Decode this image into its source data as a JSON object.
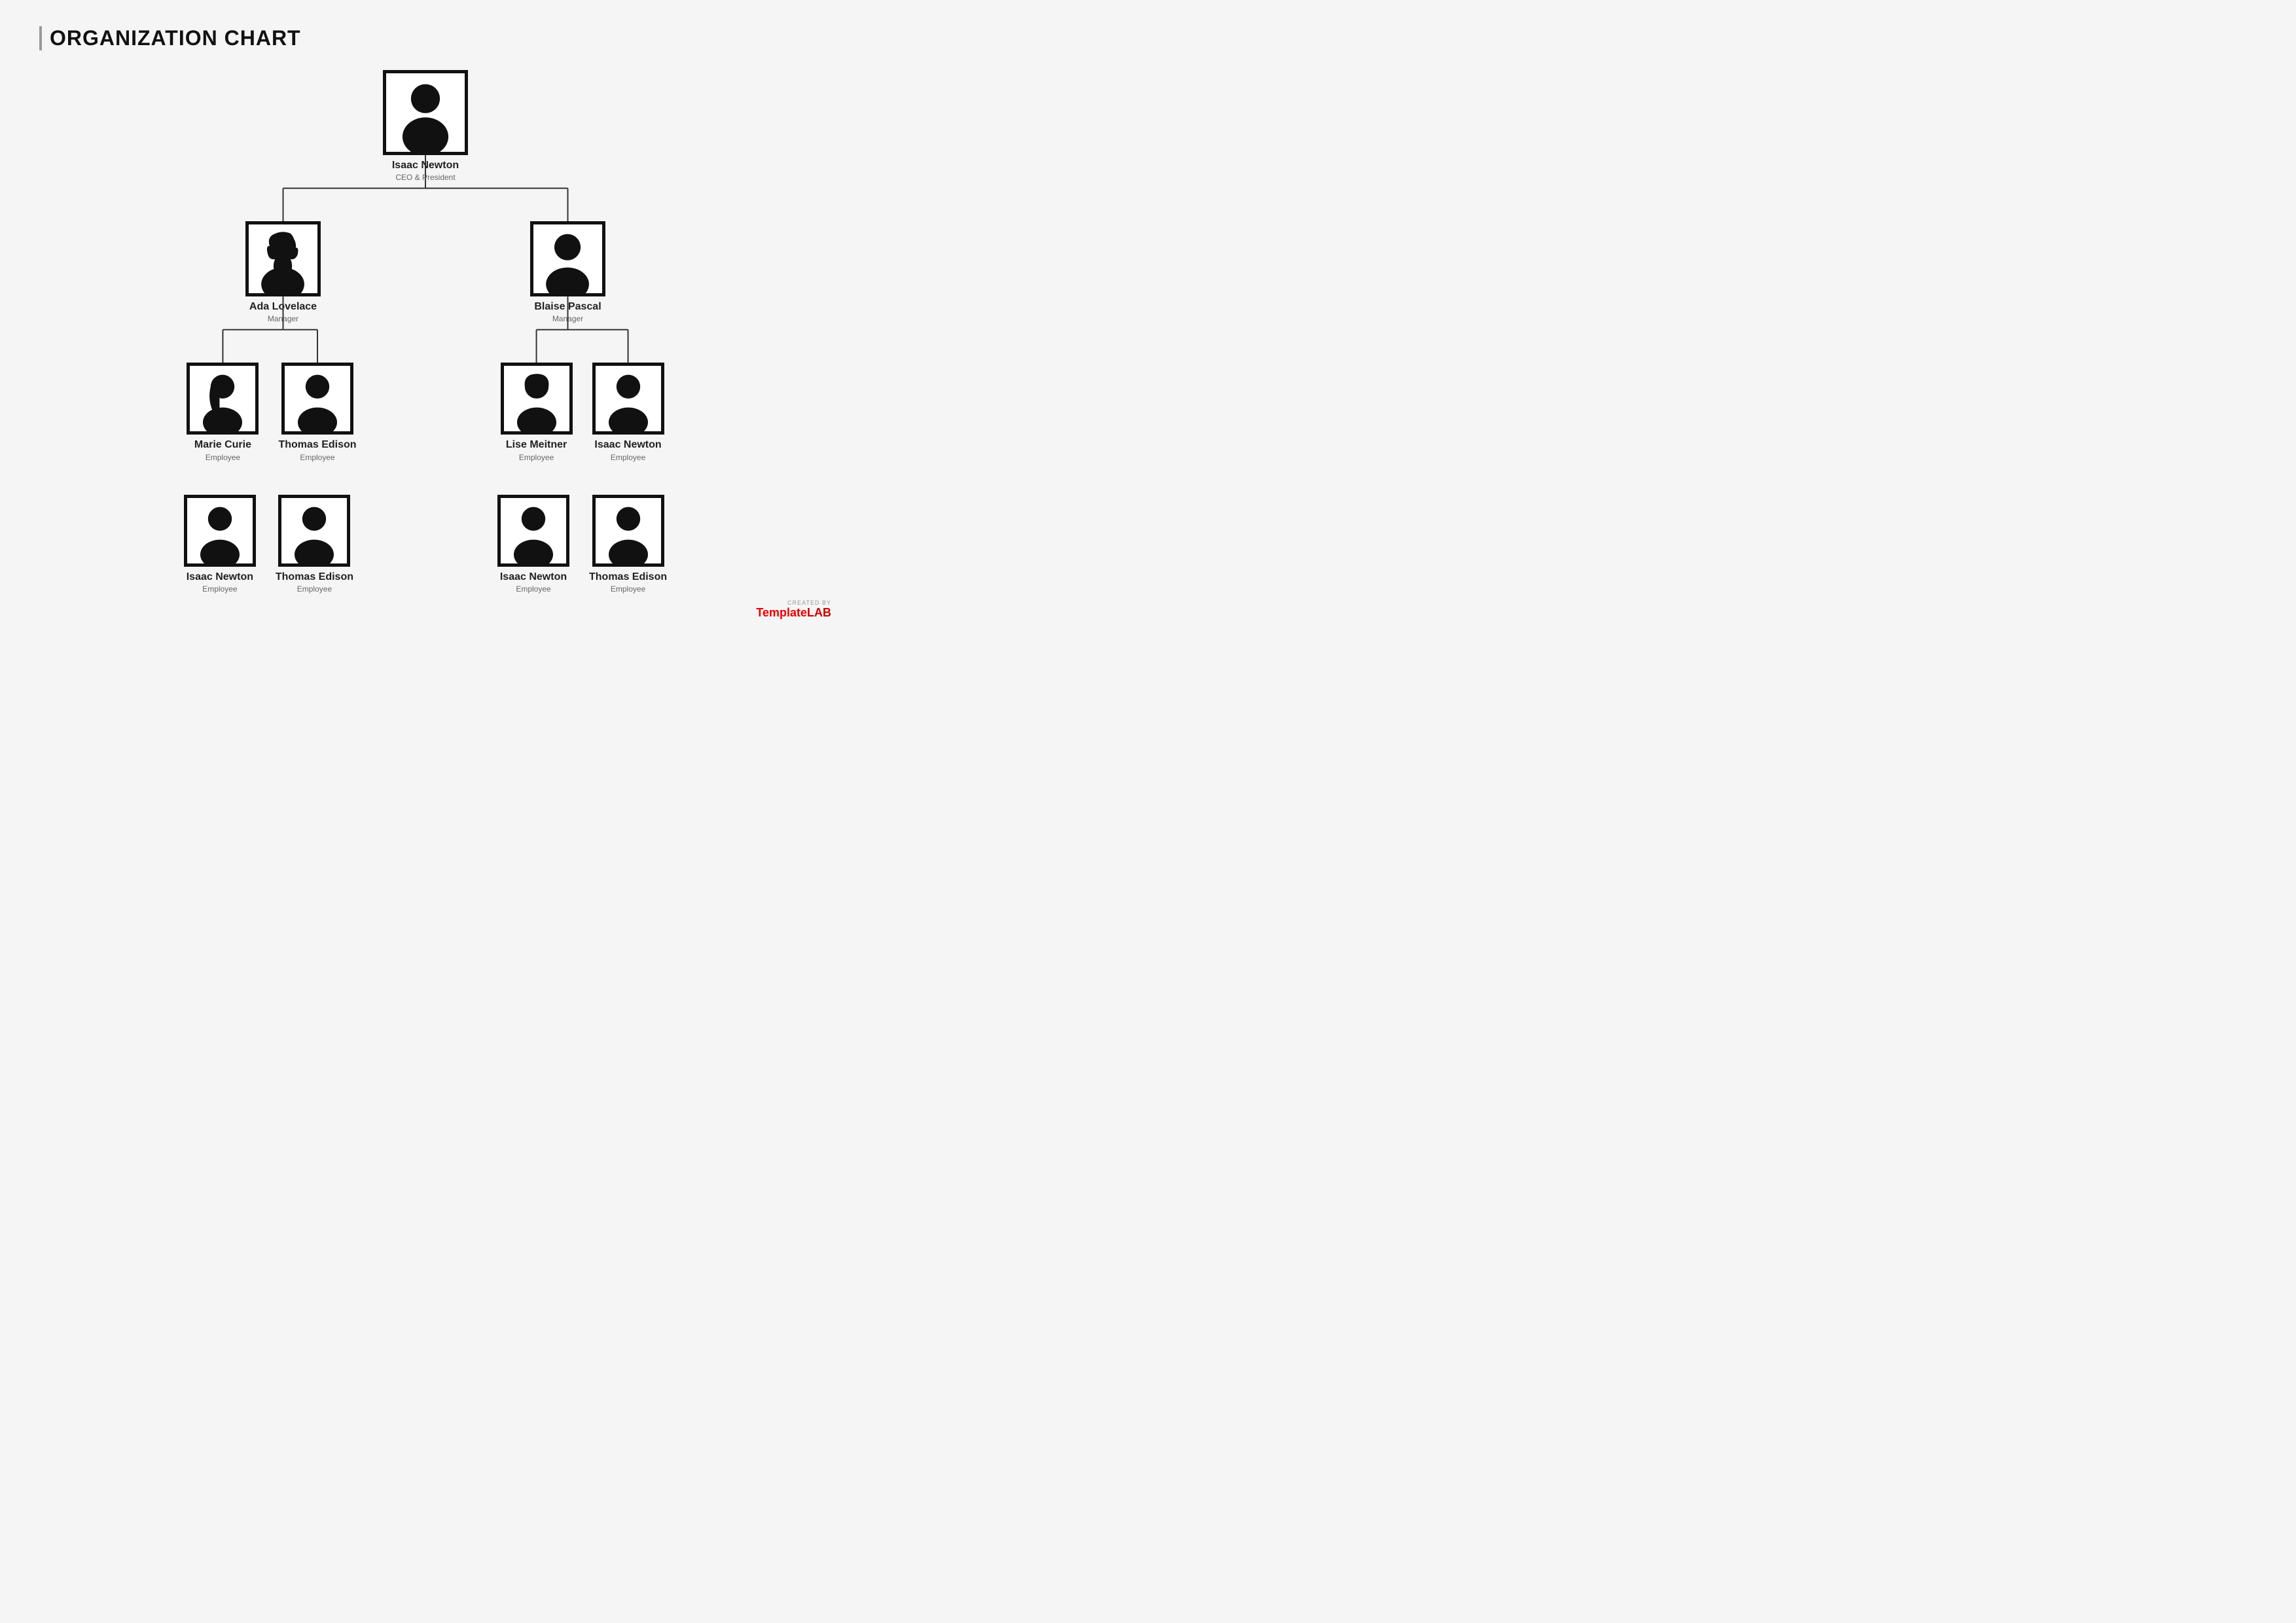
{
  "title": "ORGANIZATION CHART",
  "watermark": {
    "created_by": "CREATED BY",
    "brand_plain": "Template",
    "brand_accent": "LAB"
  },
  "nodes": {
    "ceo": {
      "name": "Isaac Newton",
      "title": "CEO & President",
      "silhouette": "male"
    },
    "manager_left": {
      "name": "Ada Lovelace",
      "title": "Manager",
      "silhouette": "female"
    },
    "manager_right": {
      "name": "Blaise Pascal",
      "title": "Manager",
      "silhouette": "male"
    },
    "employees_row1": [
      {
        "name": "Marie Curie",
        "title": "Employee",
        "silhouette": "female2"
      },
      {
        "name": "Thomas Edison",
        "title": "Employee",
        "silhouette": "male"
      },
      {
        "name": "Lise Meitner",
        "title": "Employee",
        "silhouette": "female3"
      },
      {
        "name": "Isaac Newton",
        "title": "Employee",
        "silhouette": "male2"
      }
    ],
    "employees_row2": [
      {
        "name": "Isaac Newton",
        "title": "Employee",
        "silhouette": "male3"
      },
      {
        "name": "Thomas Edison",
        "title": "Employee",
        "silhouette": "male"
      },
      {
        "name": "Isaac Newton",
        "title": "Employee",
        "silhouette": "male4"
      },
      {
        "name": "Thomas Edison",
        "title": "Employee",
        "silhouette": "male2"
      }
    ]
  }
}
